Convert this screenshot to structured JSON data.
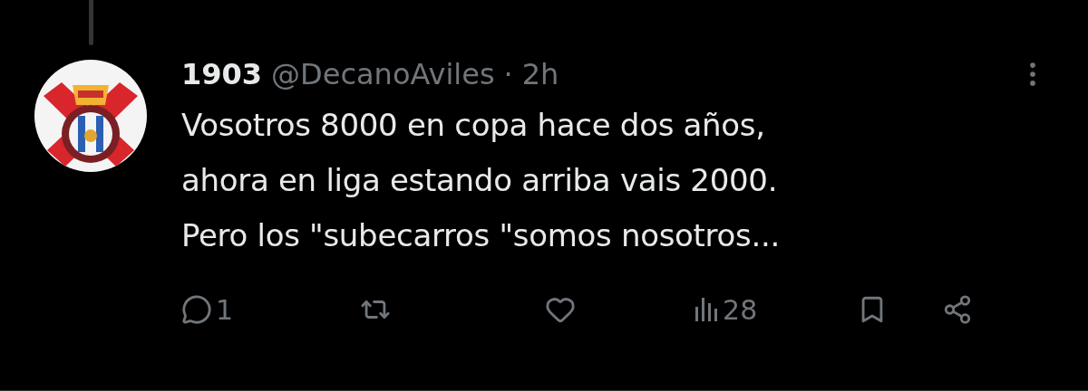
{
  "tweet": {
    "display_name": "1903",
    "handle": "@DecanoAviles",
    "separator": "·",
    "time": "2h",
    "text": "Vosotros 8000 en copa hace dos años,\nahora en liga estando arriba vais 2000.\nPero los \"subecarros \"somos nosotros...",
    "actions": [
      {
        "kind": "reply",
        "count": "1"
      },
      {
        "kind": "repost"
      },
      {
        "kind": "like"
      },
      {
        "kind": "views",
        "count": "28"
      },
      {
        "kind": "bookmark"
      },
      {
        "kind": "share"
      }
    ]
  }
}
